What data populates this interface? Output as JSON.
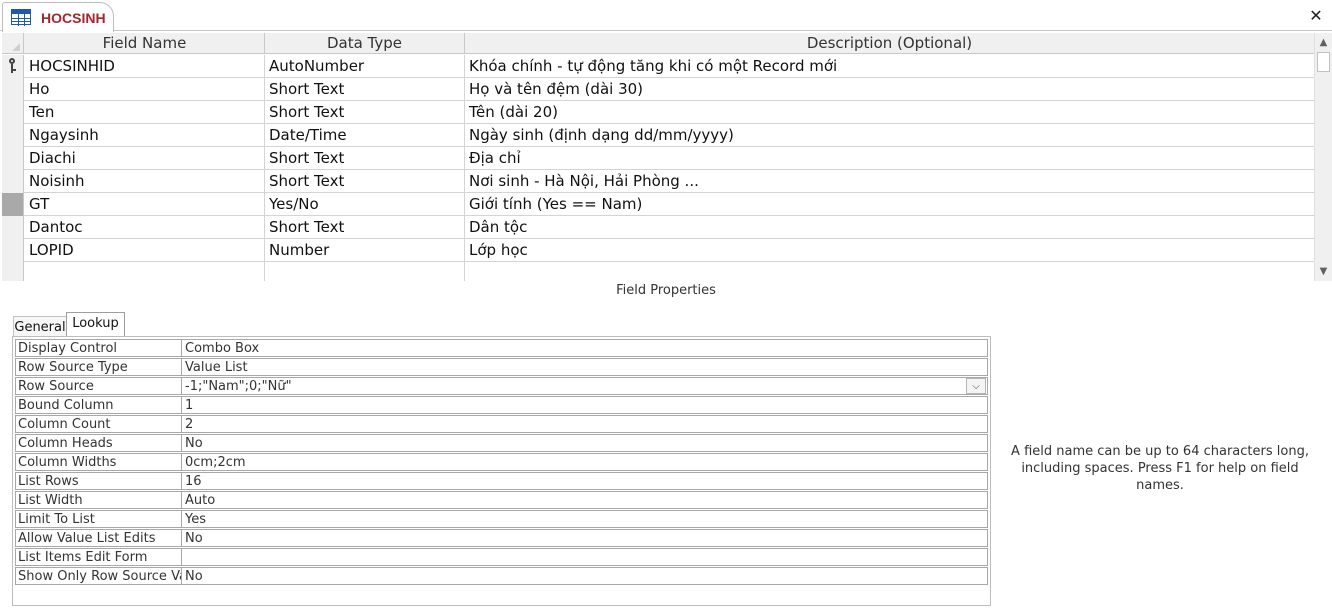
{
  "tab": {
    "title": "HOCSINH",
    "icon": "table-icon",
    "close_icon": "close-icon"
  },
  "grid": {
    "headers": [
      "Field Name",
      "Data Type",
      "Description (Optional)"
    ],
    "rows": [
      {
        "name": "HOCSINHID",
        "type": "AutoNumber",
        "desc": "Khóa chính - tự động tăng khi có một Record mới",
        "primary_key": true
      },
      {
        "name": "Ho",
        "type": "Short Text",
        "desc": "Họ và tên đệm (dài 30)"
      },
      {
        "name": "Ten",
        "type": "Short Text",
        "desc": "Tên (dài 20)"
      },
      {
        "name": "Ngaysinh",
        "type": "Date/Time",
        "desc": "Ngày sinh (định dạng dd/mm/yyyy)"
      },
      {
        "name": "Diachi",
        "type": "Short Text",
        "desc": "Địa chỉ"
      },
      {
        "name": "Noisinh",
        "type": "Short Text",
        "desc": "Nơi sinh - Hà Nội, Hải Phòng ..."
      },
      {
        "name": "GT",
        "type": "Yes/No",
        "desc": "Giới tính (Yes == Nam)",
        "selected": true
      },
      {
        "name": "Dantoc",
        "type": "Short Text",
        "desc": "Dân tộc"
      },
      {
        "name": "LOPID",
        "type": "Number",
        "desc": "Lớp học"
      },
      {
        "name": "",
        "type": "",
        "desc": ""
      }
    ]
  },
  "field_properties_label": "Field Properties",
  "property_tabs": {
    "general": "General",
    "lookup": "Lookup",
    "active": "lookup"
  },
  "properties": [
    {
      "label": "Display Control",
      "value": "Combo Box"
    },
    {
      "label": "Row Source Type",
      "value": "Value List"
    },
    {
      "label": "Row Source",
      "value": "-1;\"Nam\";0;\"Nữ\"",
      "has_dropdown": true
    },
    {
      "label": "Bound Column",
      "value": "1"
    },
    {
      "label": "Column Count",
      "value": "2"
    },
    {
      "label": "Column Heads",
      "value": "No"
    },
    {
      "label": "Column Widths",
      "value": "0cm;2cm"
    },
    {
      "label": "List Rows",
      "value": "16"
    },
    {
      "label": "List Width",
      "value": "Auto"
    },
    {
      "label": "Limit To List",
      "value": "Yes"
    },
    {
      "label": "Allow Value List Edits",
      "value": "No"
    },
    {
      "label": "List Items Edit Form",
      "value": ""
    },
    {
      "label": "Show Only Row Source Valu",
      "value": "No"
    }
  ],
  "help_text": "A field name can be up to 64 characters long, including spaces. Press F1 for help on field names.",
  "colors": {
    "tab_title": "#a4262c",
    "header_bg": "#f0f0f0",
    "selected_row": "#a9a9a9"
  }
}
